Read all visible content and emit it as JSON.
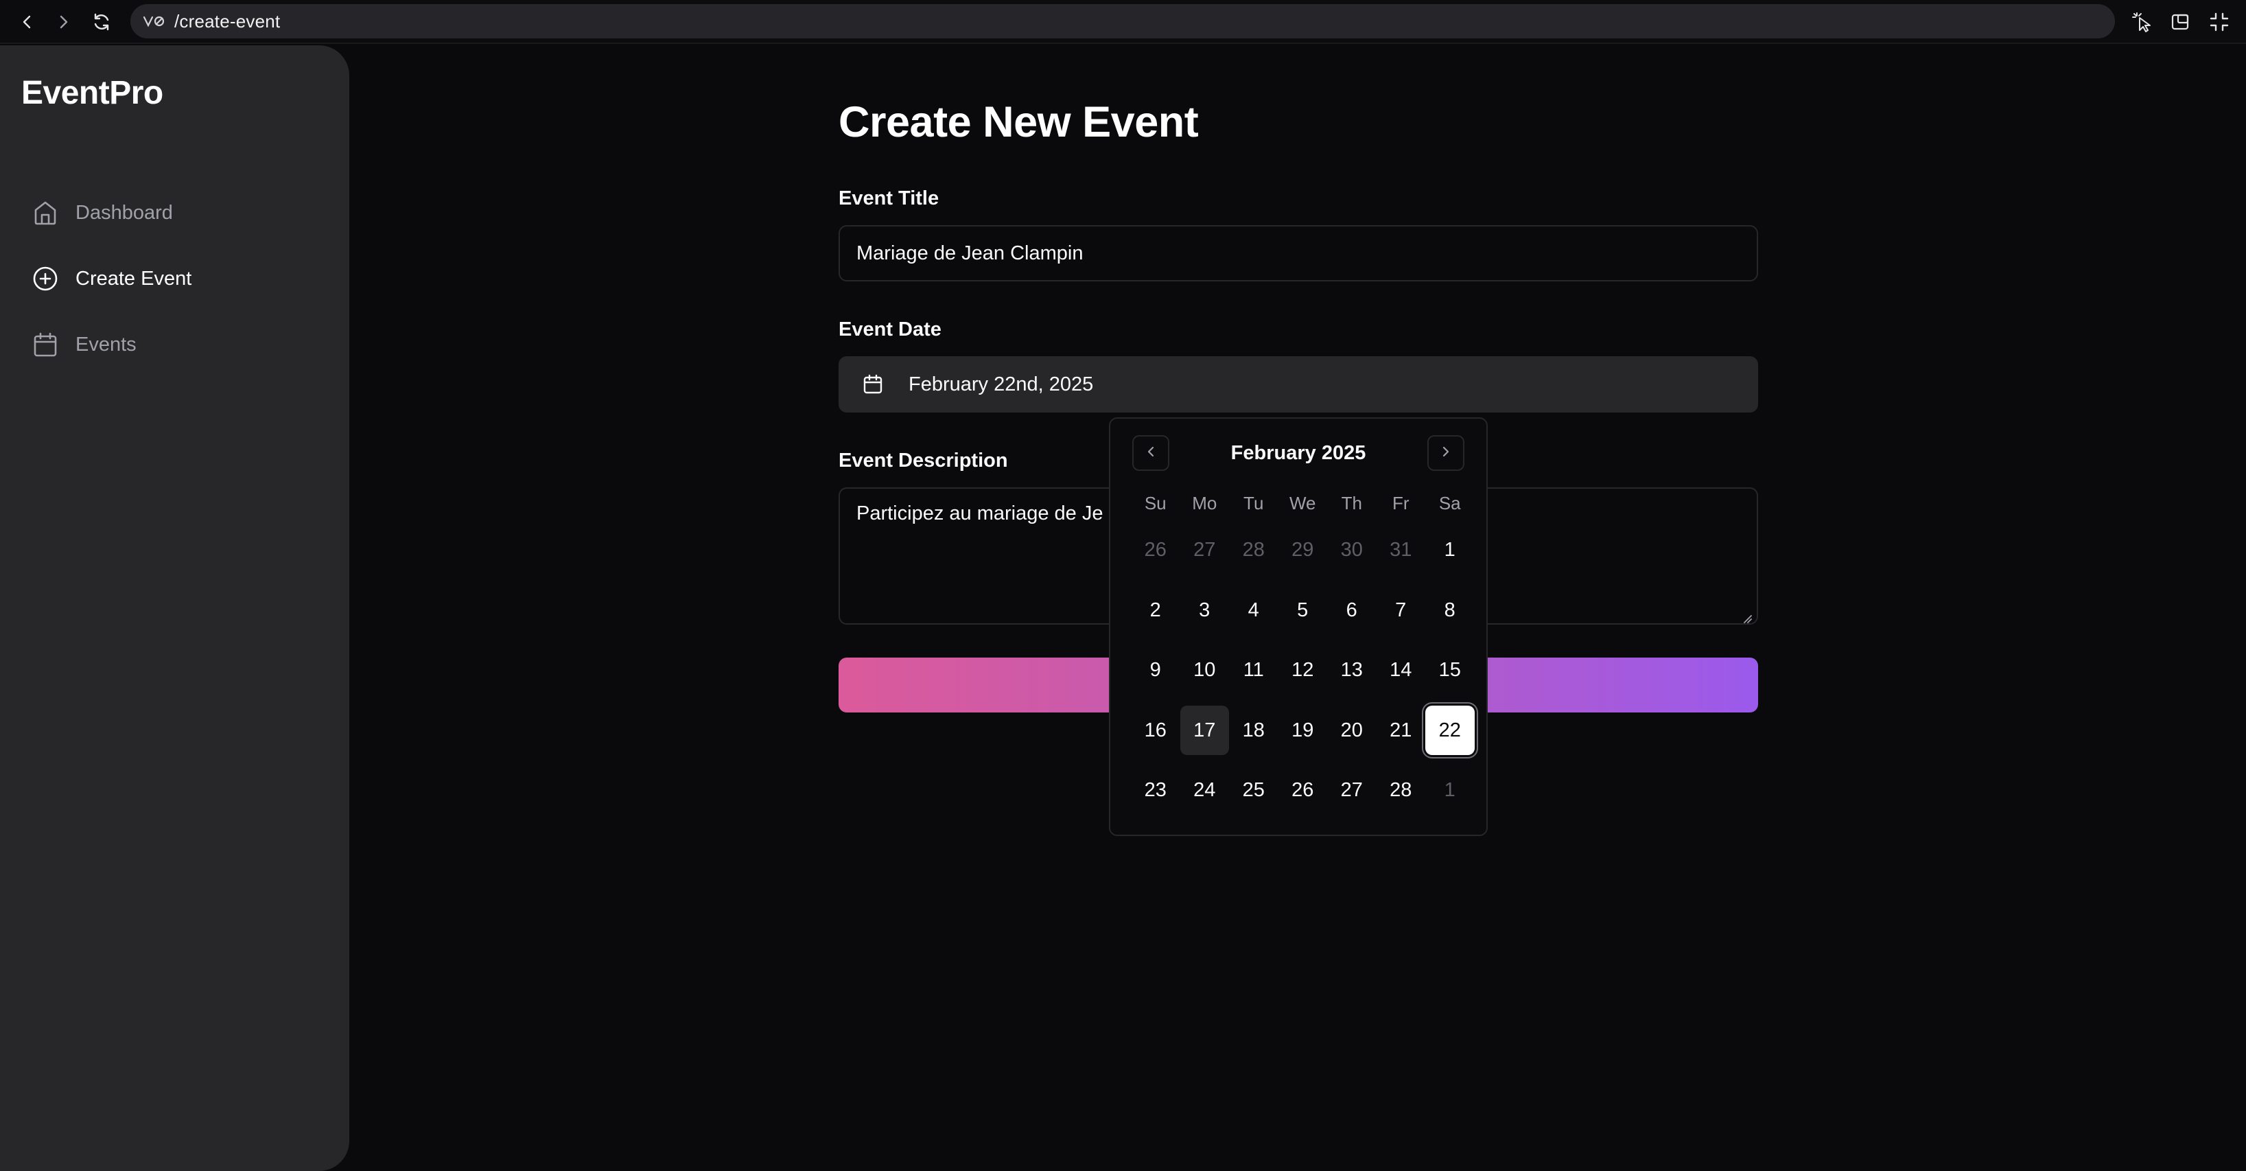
{
  "browser": {
    "url": "/create-event",
    "site_icon": "site-settings-icon",
    "buttons": [
      "back-icon",
      "forward-icon",
      "reload-icon",
      "cursor-select-icon",
      "picture-in-picture-icon",
      "exit-fullscreen-icon"
    ]
  },
  "sidebar": {
    "brand": "EventPro",
    "items": [
      {
        "label": "Dashboard",
        "icon": "home-icon",
        "active": false
      },
      {
        "label": "Create Event",
        "icon": "plus-circle-icon",
        "active": true
      },
      {
        "label": "Events",
        "icon": "calendar-icon",
        "active": false
      }
    ]
  },
  "main": {
    "title": "Create New Event",
    "event_title": {
      "label": "Event Title",
      "value": "Mariage de Jean Clampin"
    },
    "event_date": {
      "label": "Event Date",
      "value": "February 22nd, 2025"
    },
    "event_description": {
      "label": "Event Description",
      "value": "Participez au mariage de Je"
    },
    "submit_colors": [
      "#db5a9b",
      "#9b5aeb"
    ]
  },
  "calendar": {
    "month_label": "February 2025",
    "weekdays": [
      "Su",
      "Mo",
      "Tu",
      "We",
      "Th",
      "Fr",
      "Sa"
    ],
    "weeks": [
      [
        {
          "d": "26",
          "o": true
        },
        {
          "d": "27",
          "o": true
        },
        {
          "d": "28",
          "o": true
        },
        {
          "d": "29",
          "o": true
        },
        {
          "d": "30",
          "o": true
        },
        {
          "d": "31",
          "o": true
        },
        {
          "d": "1"
        }
      ],
      [
        {
          "d": "2"
        },
        {
          "d": "3"
        },
        {
          "d": "4"
        },
        {
          "d": "5"
        },
        {
          "d": "6"
        },
        {
          "d": "7"
        },
        {
          "d": "8"
        }
      ],
      [
        {
          "d": "9"
        },
        {
          "d": "10"
        },
        {
          "d": "11"
        },
        {
          "d": "12"
        },
        {
          "d": "13"
        },
        {
          "d": "14"
        },
        {
          "d": "15"
        }
      ],
      [
        {
          "d": "16"
        },
        {
          "d": "17",
          "today": true
        },
        {
          "d": "18"
        },
        {
          "d": "19"
        },
        {
          "d": "20"
        },
        {
          "d": "21"
        },
        {
          "d": "22",
          "selected": true
        }
      ],
      [
        {
          "d": "23"
        },
        {
          "d": "24"
        },
        {
          "d": "25"
        },
        {
          "d": "26"
        },
        {
          "d": "27"
        },
        {
          "d": "28"
        },
        {
          "d": "1",
          "o": true
        }
      ]
    ]
  }
}
